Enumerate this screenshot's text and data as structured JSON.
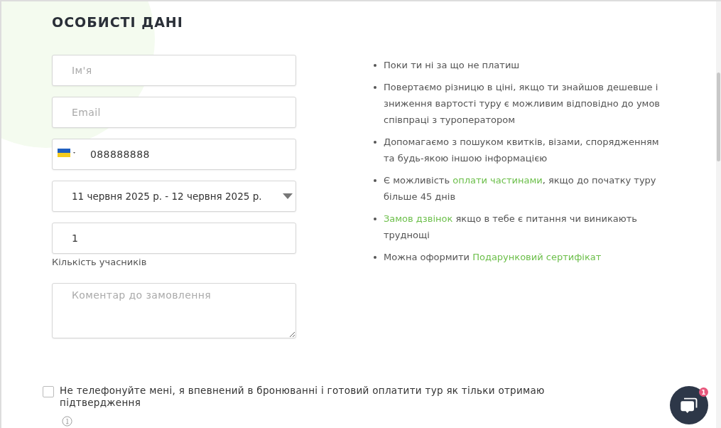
{
  "title": "ОСОБИСТІ ДАНІ",
  "fields": [
    {
      "kind": "text",
      "placeholder": "Ім'я"
    },
    {
      "kind": "text",
      "placeholder": "Email"
    },
    {
      "kind": "phone",
      "value": "088888888"
    },
    {
      "kind": "select",
      "value": "11 червня 2025 р. - 12 червня 2025 р."
    },
    {
      "kind": "text",
      "value": "1",
      "label": "Кількість учасників"
    },
    {
      "kind": "textarea",
      "placeholder": "Коментар до замовлення"
    }
  ],
  "benefits": [
    [
      {
        "kind": "text",
        "text": "Поки ти ні за що не платиш"
      }
    ],
    [
      {
        "kind": "text",
        "text": "Повертаємо різницю в ціні, якщо ти знайшов дешевше і зниження вартості туру є можливим відповідно до умов співпраці з туроператором"
      }
    ],
    [
      {
        "kind": "text",
        "text": "Допомагаємо з пошуком квитків, візами, спорядженням та будь-якою іншою інформацією"
      }
    ],
    [
      {
        "kind": "text",
        "text": "Є можливість "
      },
      {
        "kind": "link",
        "text": "оплати частинами"
      },
      {
        "kind": "text",
        "text": ", якщо до початку туру більше 45 днів"
      }
    ],
    [
      {
        "kind": "link",
        "text": "Замов дзвінок"
      },
      {
        "kind": "text",
        "text": " якщо в тебе є питання чи виникають труднощі"
      }
    ],
    [
      {
        "kind": "text",
        "text": "Можна оформити "
      },
      {
        "kind": "link",
        "text": "Подарунковий сертифікат"
      }
    ]
  ],
  "consent": {
    "checked": false,
    "label": "Не телефонуйте мені, я впевнений в бронюванні і готовий оплатити тур як тільки отримаю підтвердження"
  },
  "chat": {
    "badge": "1"
  }
}
